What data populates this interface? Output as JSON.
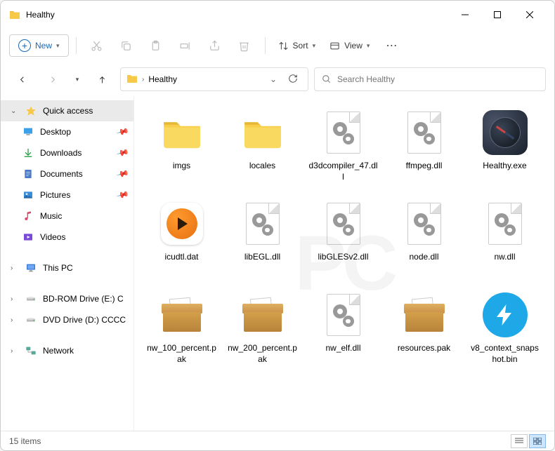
{
  "window": {
    "title": "Healthy"
  },
  "toolbar": {
    "new_label": "New",
    "sort_label": "Sort",
    "view_label": "View"
  },
  "breadcrumb": {
    "current": "Healthy"
  },
  "search": {
    "placeholder": "Search Healthy"
  },
  "sidebar": {
    "quick_access": "Quick access",
    "pinned": [
      {
        "label": "Desktop",
        "icon": "desktop"
      },
      {
        "label": "Downloads",
        "icon": "downloads"
      },
      {
        "label": "Documents",
        "icon": "documents"
      },
      {
        "label": "Pictures",
        "icon": "pictures"
      }
    ],
    "recent": [
      {
        "label": "Music",
        "icon": "music"
      },
      {
        "label": "Videos",
        "icon": "videos"
      }
    ],
    "this_pc": "This PC",
    "drives": [
      {
        "label": "BD-ROM Drive (E:) C"
      },
      {
        "label": "DVD Drive (D:) CCCC"
      }
    ],
    "network": "Network"
  },
  "items": [
    {
      "label": "imgs",
      "type": "folder"
    },
    {
      "label": "locales",
      "type": "folder"
    },
    {
      "label": "d3dcompiler_47.dll",
      "type": "dll"
    },
    {
      "label": "ffmpeg.dll",
      "type": "dll"
    },
    {
      "label": "Healthy.exe",
      "type": "compass"
    },
    {
      "label": "icudtl.dat",
      "type": "vlc"
    },
    {
      "label": "libEGL.dll",
      "type": "dll"
    },
    {
      "label": "libGLESv2.dll",
      "type": "dll"
    },
    {
      "label": "node.dll",
      "type": "dll"
    },
    {
      "label": "nw.dll",
      "type": "dll"
    },
    {
      "label": "nw_100_percent.pak",
      "type": "box"
    },
    {
      "label": "nw_200_percent.pak",
      "type": "box"
    },
    {
      "label": "nw_elf.dll",
      "type": "dll"
    },
    {
      "label": "resources.pak",
      "type": "box"
    },
    {
      "label": "v8_context_snapshot.bin",
      "type": "bolt"
    }
  ],
  "status": {
    "count": "15 items"
  }
}
